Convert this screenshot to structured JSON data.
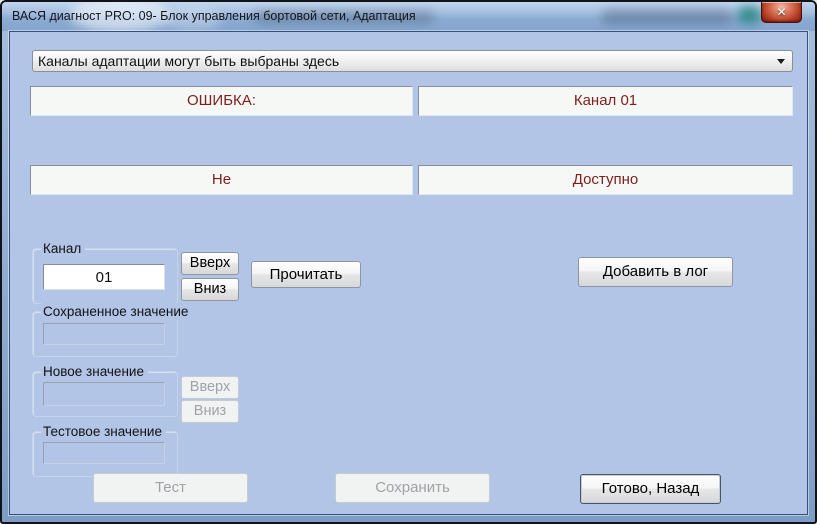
{
  "window": {
    "title": "ВАСЯ диагност PRO: 09- Блок управления бортовой сети, Адаптация",
    "close_glyph": "✕"
  },
  "dropdown": {
    "value": "Каналы адаптации могут быть выбраны здесь"
  },
  "status": {
    "left_top": "ОШИБКА:",
    "right_top": "Канал 01",
    "left_bottom": "Не",
    "right_bottom": "Доступно"
  },
  "channel": {
    "group_label": "Канал",
    "value": "01",
    "up_label": "Вверх",
    "down_label": "Вниз",
    "read_label": "Прочитать",
    "add_to_log_label": "Добавить в лог"
  },
  "stored_value": {
    "group_label": "Сохраненное значение",
    "value": ""
  },
  "new_value": {
    "group_label": "Новое значение",
    "value": "",
    "up_label": "Вверх",
    "down_label": "Вниз"
  },
  "test_value": {
    "group_label": "Тестовое значение",
    "value": ""
  },
  "actions": {
    "test_label": "Тест",
    "save_label": "Сохранить",
    "done_label": "Готово, Назад"
  },
  "colors": {
    "client_bg": "#b2c5e7",
    "panel_bg": "#f6f8f5",
    "status_text": "#7c1f1f"
  }
}
